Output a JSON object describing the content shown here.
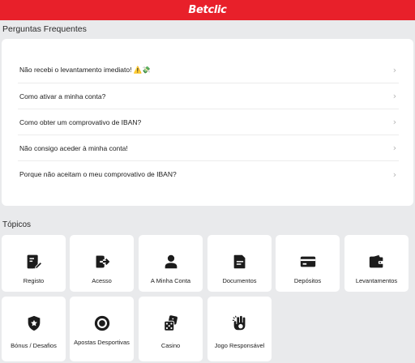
{
  "header": {
    "brand": "Betclic",
    "brand_color": "#e8202a"
  },
  "faq": {
    "title": "Perguntas Frequentes",
    "items": [
      {
        "label": "Não recebi o levantamento imediato! ⚠️💸"
      },
      {
        "label": "Como ativar a minha conta?"
      },
      {
        "label": "Como obter um comprovativo de IBAN?"
      },
      {
        "label": "Não consigo aceder à minha conta!"
      },
      {
        "label": "Porque não aceitam o meu comprovativo de IBAN?"
      }
    ]
  },
  "topics": {
    "title": "Tópicos",
    "tiles": [
      {
        "label": "Registo",
        "icon": "registration-icon"
      },
      {
        "label": "Acesso",
        "icon": "login-icon"
      },
      {
        "label": "A Minha Conta",
        "icon": "user-icon"
      },
      {
        "label": "Documentos",
        "icon": "document-icon"
      },
      {
        "label": "Depósitos",
        "icon": "card-icon"
      },
      {
        "label": "Levantamentos",
        "icon": "wallet-icon"
      },
      {
        "label": "Bónus / Desafios",
        "icon": "shield-star-icon"
      },
      {
        "label": "Apostas Desportivas",
        "icon": "soccer-ball-icon"
      },
      {
        "label": "Casino",
        "icon": "dice-icon"
      },
      {
        "label": "Jogo Responsável",
        "icon": "hand-icon"
      }
    ]
  }
}
